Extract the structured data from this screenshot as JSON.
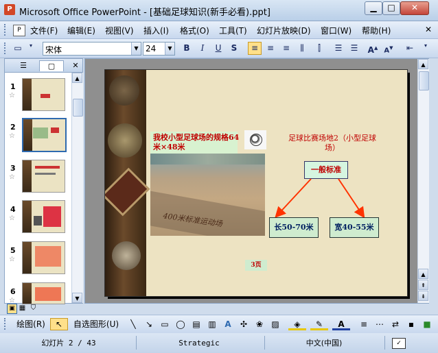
{
  "window": {
    "title": "Microsoft Office PowerPoint - [基础足球知识(新手必看).ppt]",
    "app_icon": "P"
  },
  "menubar": {
    "items": [
      "文件(F)",
      "编辑(E)",
      "视图(V)",
      "插入(I)",
      "格式(O)",
      "工具(T)",
      "幻灯片放映(D)",
      "窗口(W)",
      "帮助(H)"
    ]
  },
  "toolbar": {
    "font_name": "宋体",
    "font_size": "24",
    "bold": "B",
    "italic": "I",
    "underline": "U",
    "shadow": "S"
  },
  "thumbnails": {
    "numbers": [
      "1",
      "2",
      "3",
      "4",
      "5",
      "6"
    ],
    "star": "☆"
  },
  "slide": {
    "title": "我校小型足球场的规格64米×48米",
    "photo_caption": "400米标准运动场",
    "heading": "足球比赛场地2（小型足球场）",
    "standard_label": "一般标准",
    "length_label": "长50-70米",
    "width_label": "宽40-55米",
    "page_label": "3页"
  },
  "drawbar": {
    "draw_label": "绘图(R)",
    "autoshape_label": "自选图形(U)"
  },
  "statusbar": {
    "slide_info": "幻灯片 2 / 43",
    "theme": "Strategic",
    "language": "中文(中国)"
  },
  "colors": {
    "accent_red": "#c00000",
    "navy_text": "#002060",
    "slide_bg": "#ede3c2"
  }
}
